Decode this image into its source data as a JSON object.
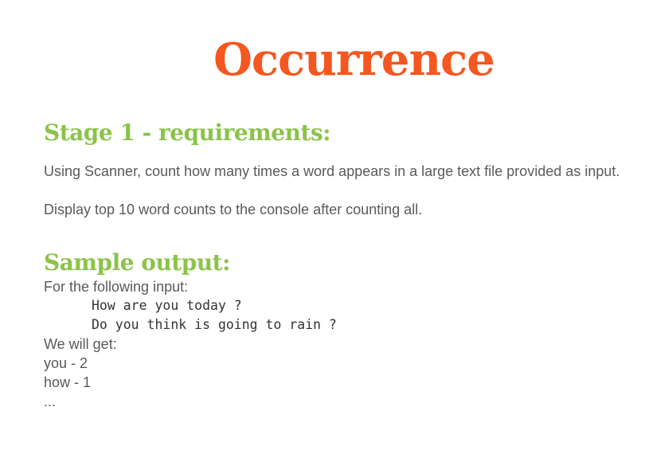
{
  "title": "Occurrence",
  "stage1": {
    "heading": "Stage 1 - requirements:",
    "para1": "Using Scanner, count how many times a word appears in a large text file provided as input.",
    "para2": "Display top 10 word counts to the console after counting all."
  },
  "sample": {
    "heading": "Sample output:",
    "intro": "For the following input:",
    "code_lines": [
      "How are you today ?",
      "Do you think is going to rain ?"
    ],
    "result_intro": "We will get:",
    "results": [
      "you - 2",
      "how - 1",
      "..."
    ]
  }
}
